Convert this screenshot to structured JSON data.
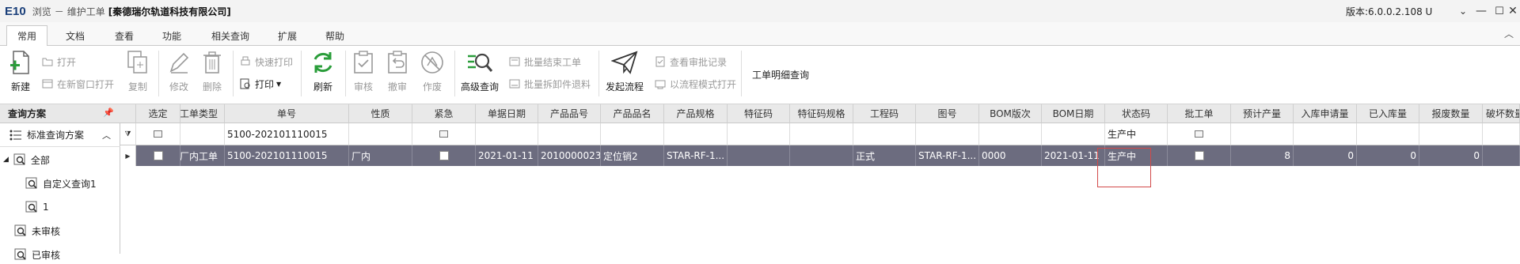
{
  "window": {
    "logo": "E10",
    "mode": "浏览",
    "dash": "－",
    "module": "维护工单",
    "company": "[秦德瑞尔轨道科技有限公司]",
    "version": "版本:6.0.0.2.108 U",
    "caret": "⌄",
    "minimize": "—",
    "maximize": "☐",
    "close": "✕"
  },
  "tabs": [
    "常用",
    "文档",
    "查看",
    "功能",
    "相关查询",
    "扩展",
    "帮助"
  ],
  "active_tab": "常用",
  "ribbon": {
    "new": "新建",
    "open": "打开",
    "open_new_window": "在新窗口打开",
    "copy": "复制",
    "edit": "修改",
    "delete": "删除",
    "quick_print": "快速打印",
    "print": "打印",
    "refresh": "刷新",
    "review": "审核",
    "unreview": "撤审",
    "void": "作废",
    "advanced_query": "高级查询",
    "batch_close": "批量结束工单",
    "batch_split": "批量拆卸件退料",
    "start_process": "发起流程",
    "view_approval": "查看审批记录",
    "process_print": "以流程模式打开",
    "detail_query": "工单明细查询"
  },
  "left_panel": {
    "header": "查询方案",
    "pin": "ᵠ",
    "scheme": "标准查询方案",
    "tree": [
      {
        "label": "全部",
        "level": 0
      },
      {
        "label": "自定义查询1",
        "level": 1
      },
      {
        "label": "1",
        "level": 1
      },
      {
        "label": "未审核",
        "level": 0
      },
      {
        "label": "已审核",
        "level": 0
      }
    ]
  },
  "grid": {
    "columns": [
      "选定",
      "工单类型",
      "单号",
      "性质",
      "紧急",
      "单据日期",
      "产品品号",
      "产品品名",
      "产品规格",
      "特征码",
      "特征码规格",
      "工程码",
      "图号",
      "BOM版次",
      "BOM日期",
      "状态码",
      "批工单",
      "预计产量",
      "入库申请量",
      "已入库量",
      "报废数量",
      "破坏数量"
    ],
    "filter_row": {
      "doc_no": "5100-202101110015",
      "status": "生产中"
    },
    "rows": [
      {
        "order_type": "厂内工单",
        "doc_no": "5100-202101110015",
        "nature": "厂内",
        "doc_date": "2021-01-11",
        "product_no": "2010000023",
        "product_name": "定位销2",
        "spec": "STAR-RF-1...",
        "feature_code": "",
        "feature_spec": "",
        "project_code": "正式",
        "drawing_no": "STAR-RF-1...",
        "bom_version": "0000",
        "bom_date": "2021-01-11",
        "status": "生产中",
        "planned_qty": "8",
        "stock_request_qty": "0",
        "stocked_qty": "0",
        "scrap_qty": "0"
      }
    ]
  }
}
